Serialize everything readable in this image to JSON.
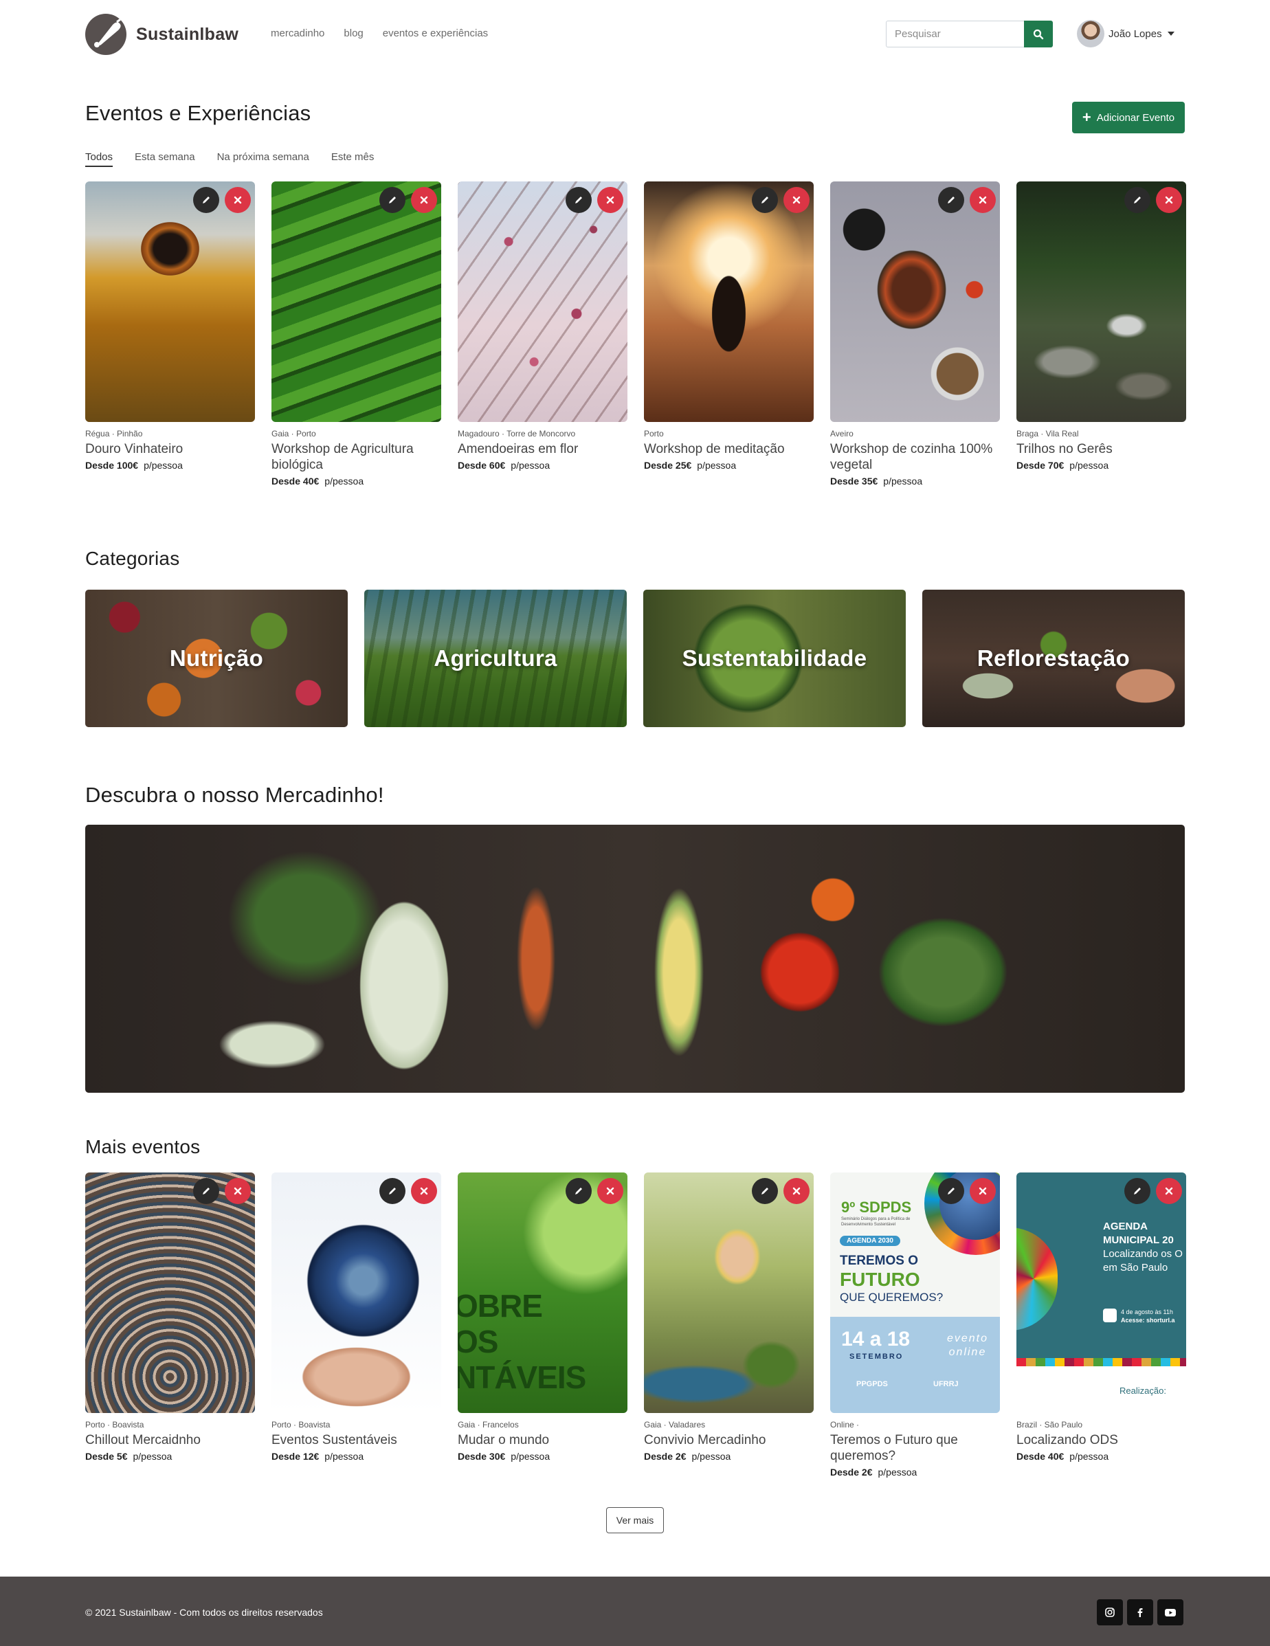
{
  "brand": {
    "name": "Sustainlbaw"
  },
  "nav": {
    "links": [
      "mercadinho",
      "blog",
      "eventos e experiências"
    ]
  },
  "search": {
    "placeholder": "Pesquisar"
  },
  "user": {
    "name": "João Lopes"
  },
  "events_section": {
    "title": "Eventos e Experiências",
    "add_label": "Adicionar Evento",
    "filters": [
      "Todos",
      "Esta semana",
      "Na próxima semana",
      "Este mês"
    ],
    "cards": [
      {
        "location": "Régua · Pinhão",
        "title": "Douro Vinhateiro",
        "price": "Desde 100€",
        "unit": "p/pessoa"
      },
      {
        "location": "Gaia · Porto",
        "title": "Workshop de Agricultura biológica",
        "price": "Desde 40€",
        "unit": "p/pessoa"
      },
      {
        "location": "Magadouro · Torre de Moncorvo",
        "title": "Amendoeiras em flor",
        "price": "Desde 60€",
        "unit": "p/pessoa"
      },
      {
        "location": "Porto",
        "title": "Workshop de meditação",
        "price": "Desde 25€",
        "unit": "p/pessoa"
      },
      {
        "location": "Aveiro",
        "title": "Workshop de cozinha 100% vegetal",
        "price": "Desde 35€",
        "unit": "p/pessoa"
      },
      {
        "location": "Braga · Vila Real",
        "title": "Trilhos no Gerês",
        "price": "Desde 70€",
        "unit": "p/pessoa"
      }
    ]
  },
  "categories_section": {
    "title": "Categorias",
    "items": [
      "Nutrição",
      "Agricultura",
      "Sustentabilidade",
      "Reflorestação"
    ]
  },
  "market_section": {
    "title": "Descubra o nosso Mercadinho!"
  },
  "more_section": {
    "title": "Mais eventos",
    "cards": [
      {
        "location": "Porto · Boavista",
        "title": "Chillout Mercaidnho",
        "price": "Desde 5€",
        "unit": "p/pessoa"
      },
      {
        "location": "Porto · Boavista",
        "title": "Eventos Sustentáveis",
        "price": "Desde 12€",
        "unit": "p/pessoa"
      },
      {
        "location": "Gaia · Francelos",
        "title": "Mudar o mundo",
        "price": "Desde 30€",
        "unit": "p/pessoa"
      },
      {
        "location": "Gaia · Valadares",
        "title": "Convivio Mercadinho",
        "price": "Desde 2€",
        "unit": "p/pessoa"
      },
      {
        "location": "Online ·",
        "title": "Teremos o Futuro que queremos?",
        "price": "Desde 2€",
        "unit": "p/pessoa"
      },
      {
        "location": "Brazil · São Paulo",
        "title": "Localizando ODS",
        "price": "Desde 40€",
        "unit": "p/pessoa"
      }
    ],
    "poster_sdpds": {
      "edition": "9º SDPDS",
      "subtitle": "Seminário Diálogos para a Política de Desenvolvimento Sustentável",
      "tag": "AGENDA 2030",
      "line1": "TEREMOS O",
      "line2": "FUTURO",
      "line3": "QUE QUEREMOS?",
      "dates": "14 a 18",
      "month": "SETEMBRO",
      "mode": "evento online",
      "org1": "PPGPDS",
      "org2": "UFRRJ"
    },
    "poster_ods": {
      "line1": "AGENDA",
      "line2": "MUNICIPAL 20",
      "line3": "Localizando os O",
      "line4": "em São Paulo",
      "date": "4 de agosto às 11h",
      "access": "Acesse: shorturl.a",
      "credit": "Realização:"
    },
    "poster_mundo": {
      "text": "OBRE\nOS\nNTÁVEIS"
    },
    "more_label": "Ver mais"
  },
  "footer": {
    "text": "© 2021 Sustainlbaw - Com todos os direitos reservados"
  },
  "icons": {
    "search": "search-icon",
    "edit": "pencil-icon",
    "delete": "close-icon",
    "instagram": "instagram-icon",
    "facebook": "facebook-icon",
    "youtube": "youtube-icon"
  },
  "colors": {
    "primary": "#1f7a4d",
    "danger": "#dc3545",
    "footer": "#4e4949"
  }
}
